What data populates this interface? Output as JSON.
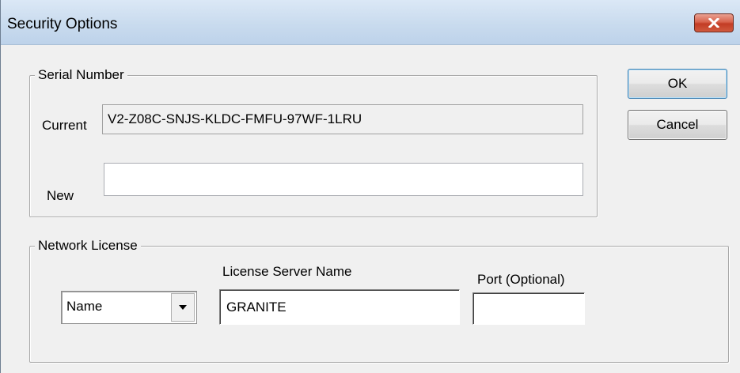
{
  "window": {
    "title": "Security Options"
  },
  "serial_number": {
    "group_label": "Serial Number",
    "current_label": "Current",
    "current_value": "V2-Z08C-SNJS-KLDC-FMFU-97WF-1LRU",
    "new_label": "New",
    "new_value": ""
  },
  "buttons": {
    "ok": "OK",
    "cancel": "Cancel"
  },
  "network_license": {
    "group_label": "Network License",
    "mode_selected": "Name",
    "server_label": "License Server Name",
    "server_value": "GRANITE",
    "port_label": "Port (Optional)",
    "port_value": ""
  }
}
